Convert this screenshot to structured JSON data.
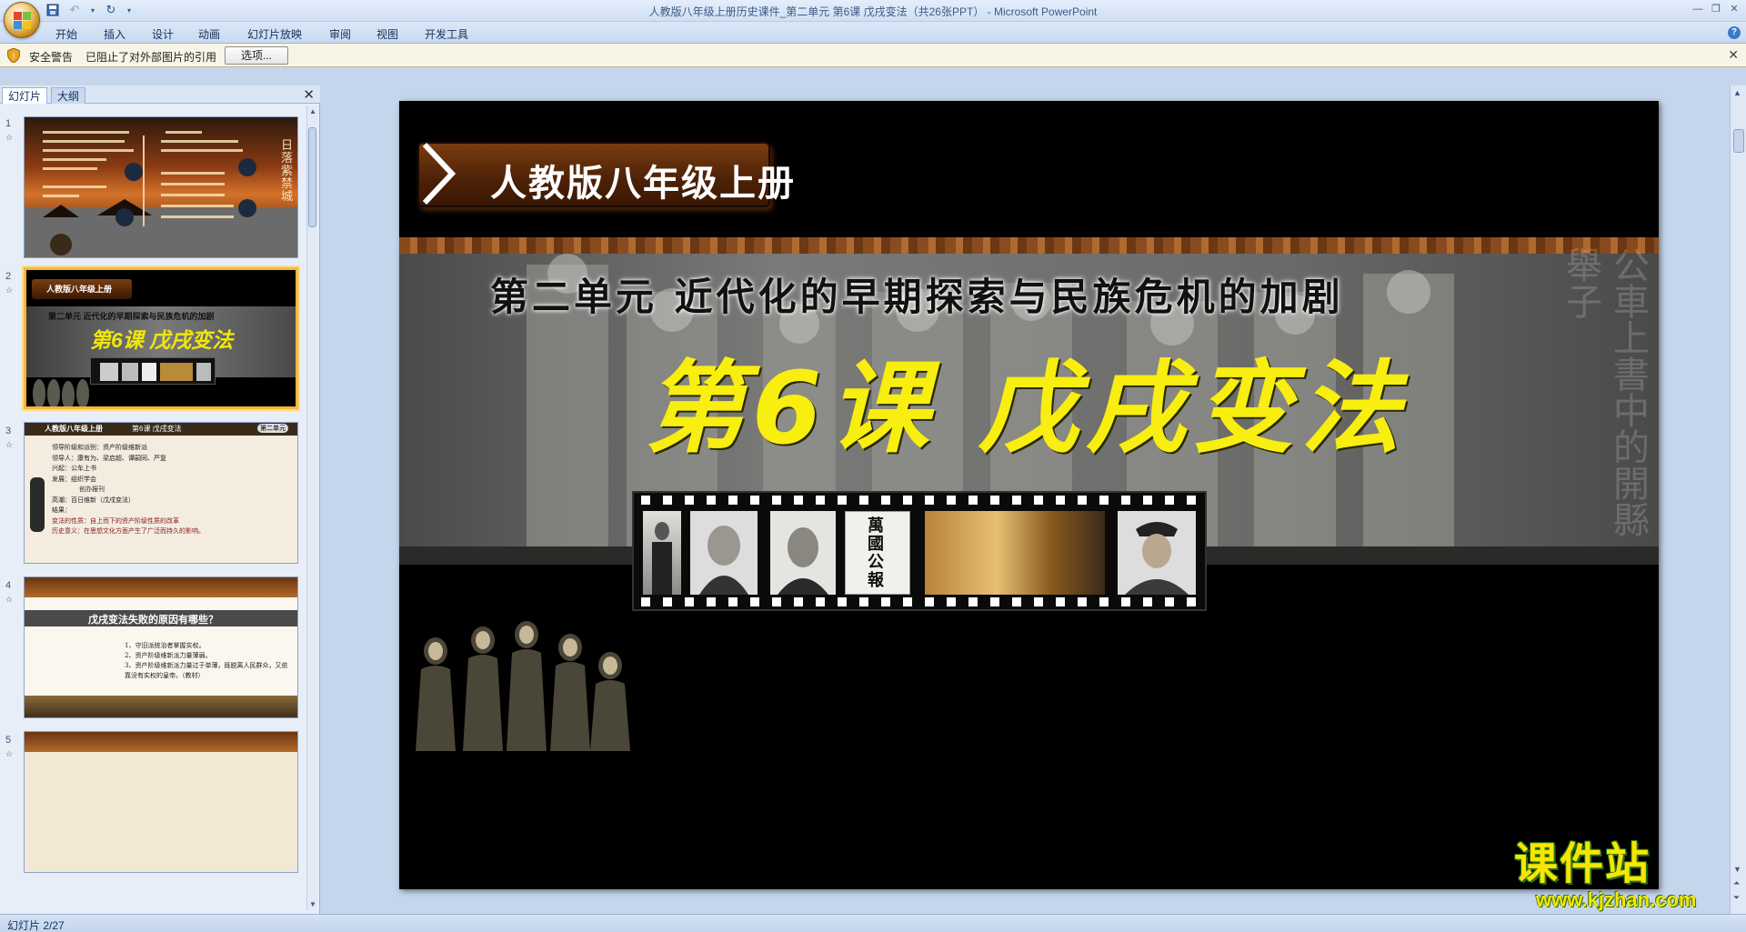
{
  "window": {
    "title": "人教版八年级上册历史课件_第二单元 第6课 戊戌变法（共26张PPT）",
    "app_name": "Microsoft PowerPoint"
  },
  "ribbon": {
    "tabs": [
      "开始",
      "插入",
      "设计",
      "动画",
      "幻灯片放映",
      "审阅",
      "视图",
      "开发工具"
    ]
  },
  "security_bar": {
    "label": "安全警告",
    "message": "已阻止了对外部图片的引用",
    "options_button": "选项..."
  },
  "left_panel": {
    "tabs": [
      "幻灯片",
      "大纲"
    ],
    "active_tab": "幻灯片",
    "slides": [
      {
        "number": "1",
        "title": "日落紫禁城"
      },
      {
        "number": "2",
        "title": "人教版八年级上册",
        "subtitle": "第二单元 近代化的早期探索与民族危机的加剧",
        "lesson": "第6课 戊戌变法",
        "selected": true
      },
      {
        "number": "3",
        "header": "人教版八年级上册",
        "lesson": "第6课 戊戌变法",
        "badge": "第二单元",
        "lines": [
          "领导阶级和派别：资产阶级维新派",
          "领导人：康有为、梁启超、谭嗣同、严复",
          "兴起：公车上书",
          "发展：组织学会",
          "创办报刊",
          "高潮：百日维新（戊戌变法）",
          "结果：",
          "变法的性质：自上而下的资产阶级性质的改革",
          "历史意义：在思想文化方面产生了广泛而持久的影响。"
        ]
      },
      {
        "number": "4",
        "question": "戊戌变法失败的原因有哪些？",
        "lines": [
          "1、守旧派统治者掌握实权。",
          "2、资产阶级维新派力量薄弱。",
          "3、资产阶级维新派力量过于单薄，既脱离人民群众，又依靠没有实权的皇帝。（教材）"
        ]
      },
      {
        "number": "5"
      }
    ]
  },
  "slide": {
    "badge_title": "人教版八年级上册",
    "unit_title": "第二单元  近代化的早期探索与民族危机的加剧",
    "lesson_title": "第6课  戊戌变法",
    "newspaper_title": "萬國公報",
    "side_text": "公車上書中的開縣舉子"
  },
  "status_bar": {
    "slide_count": "幻灯片 2/27"
  },
  "watermark": {
    "brand": "课件站",
    "url": "www.kjzhan.com"
  },
  "colors": {
    "accent_yellow": "#f8ee10",
    "title_brown": "#4c2006",
    "ribbon_bg": "#dbe7f7",
    "selection": "#f6b73c"
  }
}
